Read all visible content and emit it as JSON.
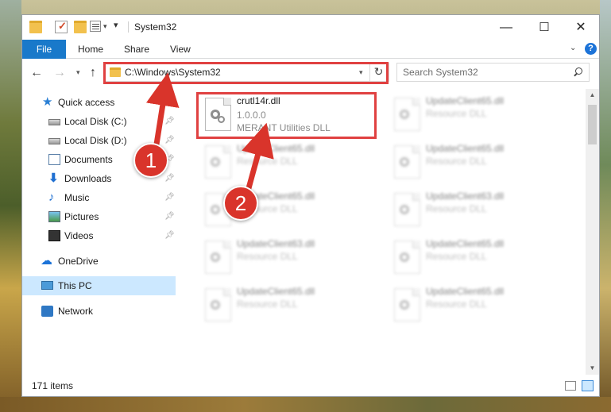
{
  "window": {
    "title": "System32",
    "minimize_glyph": "—",
    "maximize_glyph": "☐",
    "close_glyph": "✕"
  },
  "ribbon": {
    "tabs": [
      "File",
      "Home",
      "Share",
      "View"
    ]
  },
  "navigation": {
    "back_glyph": "←",
    "forward_glyph": "→",
    "recent_glyph": "▾",
    "up_glyph": "↑",
    "address": "C:\\Windows\\System32",
    "refresh_glyph": "↻",
    "search_placeholder": "Search System32"
  },
  "sidebar": {
    "items": [
      {
        "label": "Quick access",
        "icon": "star-icon"
      },
      {
        "label": "Local Disk (C:)",
        "icon": "drive-icon",
        "pinned": true
      },
      {
        "label": "Local Disk (D:)",
        "icon": "drive-icon",
        "pinned": true
      },
      {
        "label": "Documents",
        "icon": "documents-icon",
        "pinned": true
      },
      {
        "label": "Downloads",
        "icon": "downloads-icon",
        "pinned": true
      },
      {
        "label": "Music",
        "icon": "music-icon",
        "pinned": true
      },
      {
        "label": "Pictures",
        "icon": "pictures-icon",
        "pinned": true
      },
      {
        "label": "Videos",
        "icon": "videos-icon",
        "pinned": true
      },
      {
        "label": "OneDrive",
        "icon": "onedrive-icon"
      },
      {
        "label": "This PC",
        "icon": "pc-icon",
        "selected": true
      },
      {
        "label": "Network",
        "icon": "network-icon"
      }
    ]
  },
  "files": [
    {
      "name": "crutl14r.dll",
      "line1": "1.0.0.0",
      "line2": "MERANT Utilities DLL",
      "highlighted": true
    },
    {
      "name": "UpdateClient65.dll",
      "line1": "Resource DLL"
    },
    {
      "name": "UpdateClient65.dll",
      "line1": "Resource DLL"
    },
    {
      "name": "UpdateClient65.dll",
      "line1": "Resource DLL"
    },
    {
      "name": "UpdateClient65.dll",
      "line1": "Resource DLL"
    },
    {
      "name": "UpdateClient63.dll",
      "line1": "Resource DLL"
    },
    {
      "name": "UpdateClient63.dll",
      "line1": "Resource DLL"
    },
    {
      "name": "UpdateClient65.dll",
      "line1": "Resource DLL"
    },
    {
      "name": "UpdateClient65.dll",
      "line1": "Resource DLL"
    },
    {
      "name": "UpdateClient65.dll",
      "line1": "Resource DLL"
    }
  ],
  "status": {
    "item_count": "171 items"
  },
  "callouts": [
    "1",
    "2"
  ],
  "colors": {
    "accent": "#1979ca",
    "highlight": "#e04141",
    "callout": "#d9342b",
    "selection": "#cce8ff"
  }
}
